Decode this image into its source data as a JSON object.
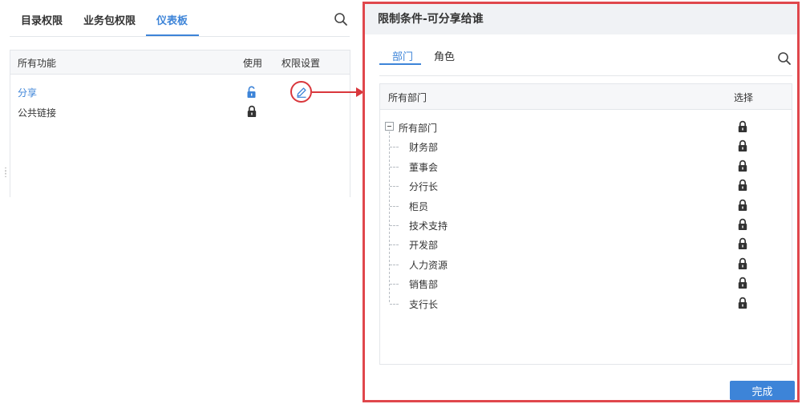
{
  "left": {
    "tabs": [
      {
        "label": "目录权限",
        "active": false
      },
      {
        "label": "业务包权限",
        "active": false
      },
      {
        "label": "仪表板",
        "active": true
      }
    ],
    "table": {
      "col_function": "所有功能",
      "col_use": "使用",
      "col_setting": "权限设置",
      "rows": [
        {
          "label": "分享",
          "use_icon": "unlock-icon",
          "setting_icon": "edit-icon"
        },
        {
          "label": "公共链接",
          "use_icon": "lock-icon"
        }
      ]
    }
  },
  "dialog": {
    "title": "限制条件-可分享给谁",
    "tabs": [
      {
        "label": "部门",
        "active": true
      },
      {
        "label": "角色",
        "active": false
      }
    ],
    "table": {
      "col_dept": "所有部门",
      "col_select": "选择",
      "root": "所有部门",
      "children": [
        "财务部",
        "董事会",
        "分行长",
        "柜员",
        "技术支持",
        "开发部",
        "人力资源",
        "销售部",
        "支行长"
      ]
    },
    "done_label": "完成"
  },
  "colors": {
    "accent": "#3d84d8",
    "highlight": "#d9373c"
  }
}
